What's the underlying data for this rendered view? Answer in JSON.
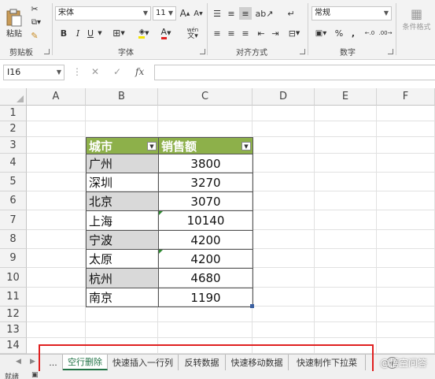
{
  "ribbon": {
    "clipboard": {
      "paste_label": "粘贴",
      "group_label": "剪贴板"
    },
    "font": {
      "font_name": "宋体",
      "font_size": "11",
      "bold": "B",
      "italic": "I",
      "underline": "U",
      "group_label": "字体",
      "phonetic": "wén"
    },
    "alignment": {
      "group_label": "对齐方式"
    },
    "number": {
      "format": "常规",
      "percent": "%",
      "comma": ",",
      "group_label": "数字"
    },
    "styles": {
      "cond_format_label": "条件格式"
    }
  },
  "formula_bar": {
    "name_box": "I16",
    "cancel": "✕",
    "enter": "✓",
    "fx": "fx",
    "value": ""
  },
  "columns": [
    "A",
    "B",
    "C",
    "D",
    "E",
    "F"
  ],
  "rows": [
    "1",
    "2",
    "3",
    "4",
    "5",
    "6",
    "7",
    "8",
    "9",
    "10",
    "11",
    "12",
    "13",
    "14"
  ],
  "table": {
    "headers": [
      "城市",
      "销售额"
    ],
    "rows": [
      {
        "city": "广州",
        "sales": "3800"
      },
      {
        "city": "深圳",
        "sales": "3270"
      },
      {
        "city": "北京",
        "sales": "3070"
      },
      {
        "city": "上海",
        "sales": "10140"
      },
      {
        "city": "宁波",
        "sales": "4200"
      },
      {
        "city": "太原",
        "sales": "4200"
      },
      {
        "city": "杭州",
        "sales": "4680"
      },
      {
        "city": "南京",
        "sales": "1190"
      }
    ]
  },
  "sheet_tabs": {
    "ellipsis": "...",
    "tabs": [
      "空行删除",
      "快速插入一行列",
      "反转数据",
      "快速移动数据",
      "快速制作下拉菜"
    ],
    "active_index": 0,
    "add_label": "+"
  },
  "status": {
    "ready": "就绪"
  },
  "watermark": "@悟空问答",
  "colors": {
    "header_green": "#8db04a",
    "tab_active": "#217346",
    "highlight_red": "#e02020"
  }
}
